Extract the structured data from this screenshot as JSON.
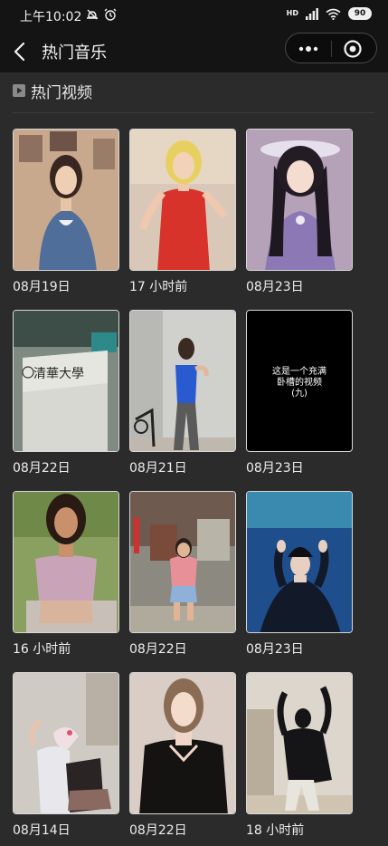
{
  "status_bar": {
    "time": "上午10:02",
    "network_label": "HD",
    "battery": "90"
  },
  "nav": {
    "title": "热门音乐"
  },
  "section": {
    "title": "热门视频"
  },
  "videos": [
    {
      "date": "08月19日"
    },
    {
      "date": "17 小时前"
    },
    {
      "date": "08月23日"
    },
    {
      "date": "08月22日"
    },
    {
      "date": "08月21日"
    },
    {
      "date": "08月23日",
      "overlay_text": "这是一个充满\n卧槽的视频\n(九)"
    },
    {
      "date": "16 小时前"
    },
    {
      "date": "08月22日"
    },
    {
      "date": "08月23日"
    },
    {
      "date": "08月14日"
    },
    {
      "date": "08月22日"
    },
    {
      "date": "18 小时前"
    }
  ],
  "colors": {
    "background": "#2b2b2c",
    "bar": "#141414",
    "text": "#eeeeee",
    "thumb_border": "#d8d8d8"
  }
}
